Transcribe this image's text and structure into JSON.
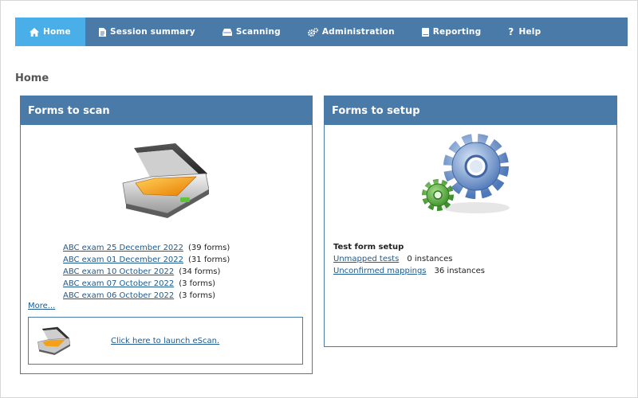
{
  "nav": {
    "items": [
      {
        "label": "Home",
        "icon": "home-icon",
        "active": true
      },
      {
        "label": "Session summary",
        "icon": "document-icon"
      },
      {
        "label": "Scanning",
        "icon": "scanner-icon"
      },
      {
        "label": "Administration",
        "icon": "gears-icon"
      },
      {
        "label": "Reporting",
        "icon": "book-icon"
      },
      {
        "label": "Help",
        "icon": "question-icon"
      }
    ]
  },
  "page": {
    "title": "Home"
  },
  "forms_to_scan": {
    "title": "Forms to scan",
    "exams": [
      {
        "name": "ABC exam 25 December 2022",
        "count": "(39 forms)"
      },
      {
        "name": "ABC exam 01 December 2022",
        "count": "(31 forms)"
      },
      {
        "name": "ABC exam 10 October 2022",
        "count": "(34 forms)"
      },
      {
        "name": "ABC exam 07 October 2022",
        "count": "(3 forms)"
      },
      {
        "name": "ABC exam 06 October 2022",
        "count": "(3 forms)"
      }
    ],
    "more_label": "More...",
    "launch_label": "Click here to launch eScan."
  },
  "forms_to_setup": {
    "title": "Forms to setup",
    "section_title": "Test form setup",
    "rows": [
      {
        "label": "Unmapped tests",
        "count": "0 instances"
      },
      {
        "label": "Unconfirmed mappings",
        "count": "36 instances"
      }
    ]
  },
  "colors": {
    "nav_bg": "#4a7aa8",
    "nav_active": "#4aaee8",
    "link": "#1c5a8f"
  }
}
